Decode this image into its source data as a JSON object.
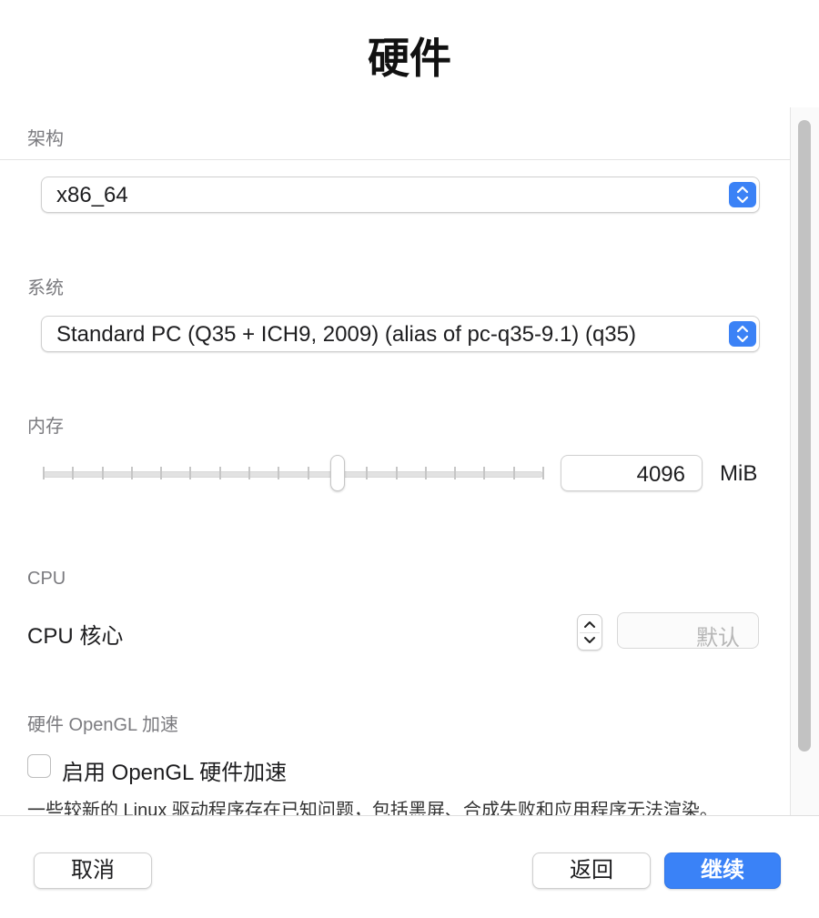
{
  "title": "硬件",
  "architecture": {
    "label": "架构",
    "value": "x86_64"
  },
  "system": {
    "label": "系统",
    "value": "Standard PC (Q35 + ICH9, 2009) (alias of pc-q35-9.1) (q35)"
  },
  "memory": {
    "label": "内存",
    "value": "4096",
    "unit": "MiB",
    "slider_fraction": 0.59
  },
  "cpu": {
    "section_label": "CPU",
    "cores_label": "CPU 核心",
    "cores_placeholder": "默认"
  },
  "opengl": {
    "section_label": "硬件 OpenGL 加速",
    "checkbox_label": "启用 OpenGL 硬件加速",
    "checked": false,
    "note": "一些较新的 Linux 驱动程序存在已知问题，包括黑屏、合成失败和应用程序无法渲染。"
  },
  "buttons": {
    "cancel": "取消",
    "back": "返回",
    "continue": "继续"
  },
  "colors": {
    "accent": "#3a82f7"
  }
}
